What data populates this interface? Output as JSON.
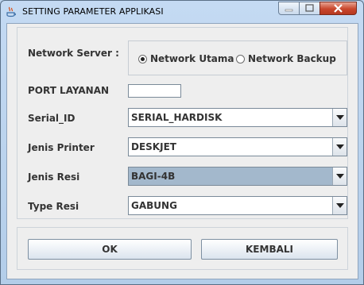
{
  "window": {
    "title": "SETTING PARAMETER APPLIKASI",
    "icon": "java-icon",
    "controls": [
      "minimize-icon",
      "maximize-icon",
      "close-icon"
    ]
  },
  "form": {
    "network_server": {
      "label": "Network Server :",
      "options": [
        {
          "label": "Network Utama",
          "selected": true
        },
        {
          "label": "Network Backup",
          "selected": false
        }
      ]
    },
    "port_layanan": {
      "label": "PORT LAYANAN",
      "value": ""
    },
    "serial_id": {
      "label": "Serial_ID",
      "value": "SERIAL_HARDISK"
    },
    "jenis_printer": {
      "label": "Jenis Printer",
      "value": "DESKJET"
    },
    "jenis_resi": {
      "label": "Jenis Resi",
      "value": "BAGI-4B"
    },
    "type_resi": {
      "label": "Type Resi",
      "value": "GABUNG"
    }
  },
  "buttons": {
    "ok": "OK",
    "kembali": "KEMBALI"
  },
  "colors": {
    "title_bar": "#c4daf3",
    "selected_combo": "#a3b8cc",
    "close_button": "#c9462c"
  }
}
